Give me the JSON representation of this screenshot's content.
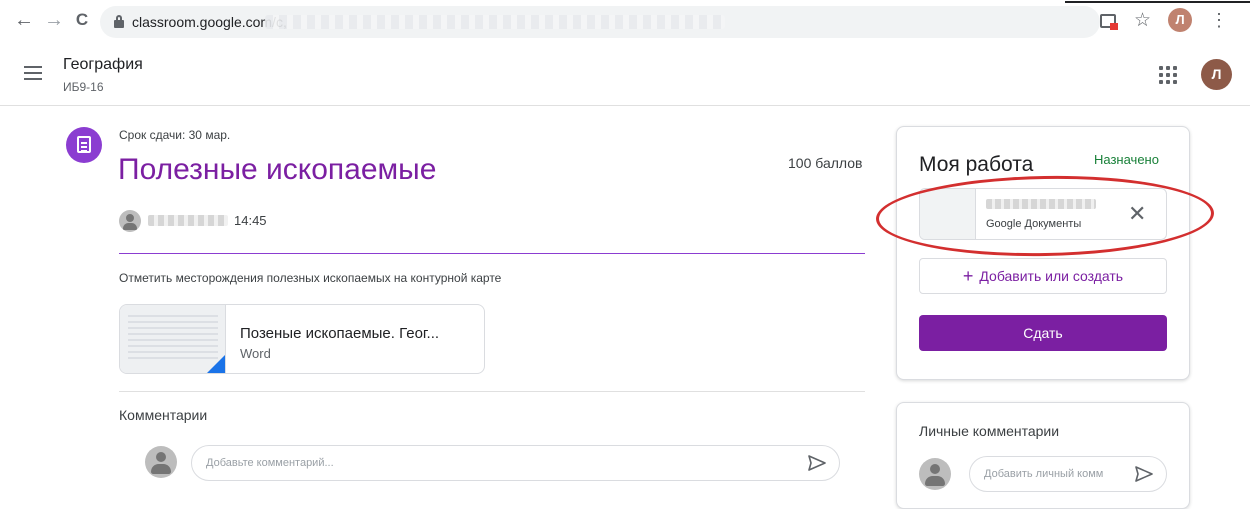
{
  "browser": {
    "back": "←",
    "forward": "→",
    "reload": "C",
    "url": "classroom.google.com/c,",
    "star": "☆",
    "profile_initial": "Л",
    "menu": "⋮"
  },
  "header": {
    "class_title": "География",
    "class_section": "ИБ9-16",
    "avatar_initial": "Л"
  },
  "assignment": {
    "due": "Срок сдачи: 30 мар.",
    "title": "Полезные ископаемые",
    "points": "100 баллов",
    "time": "14:45",
    "description": "Отметить месторождения полезных ископаемых на контурной карте",
    "attachment": {
      "title": "Позеные ископаемые. Геог...",
      "type": "Word"
    }
  },
  "comments": {
    "heading": "Комментарии",
    "placeholder": "Добавьте комментарий..."
  },
  "my_work": {
    "title": "Моя работа",
    "status": "Назначено",
    "file_type": "Google Документы",
    "close": "✕",
    "add_create": "Добавить или создать",
    "add_plus": "+",
    "submit": "Сдать"
  },
  "private_comments": {
    "heading": "Личные комментарии",
    "placeholder": "Добавить личный комм"
  },
  "colors": {
    "accent": "#7b1fa2",
    "assigned": "#188038",
    "annotation": "#d32f2f"
  }
}
